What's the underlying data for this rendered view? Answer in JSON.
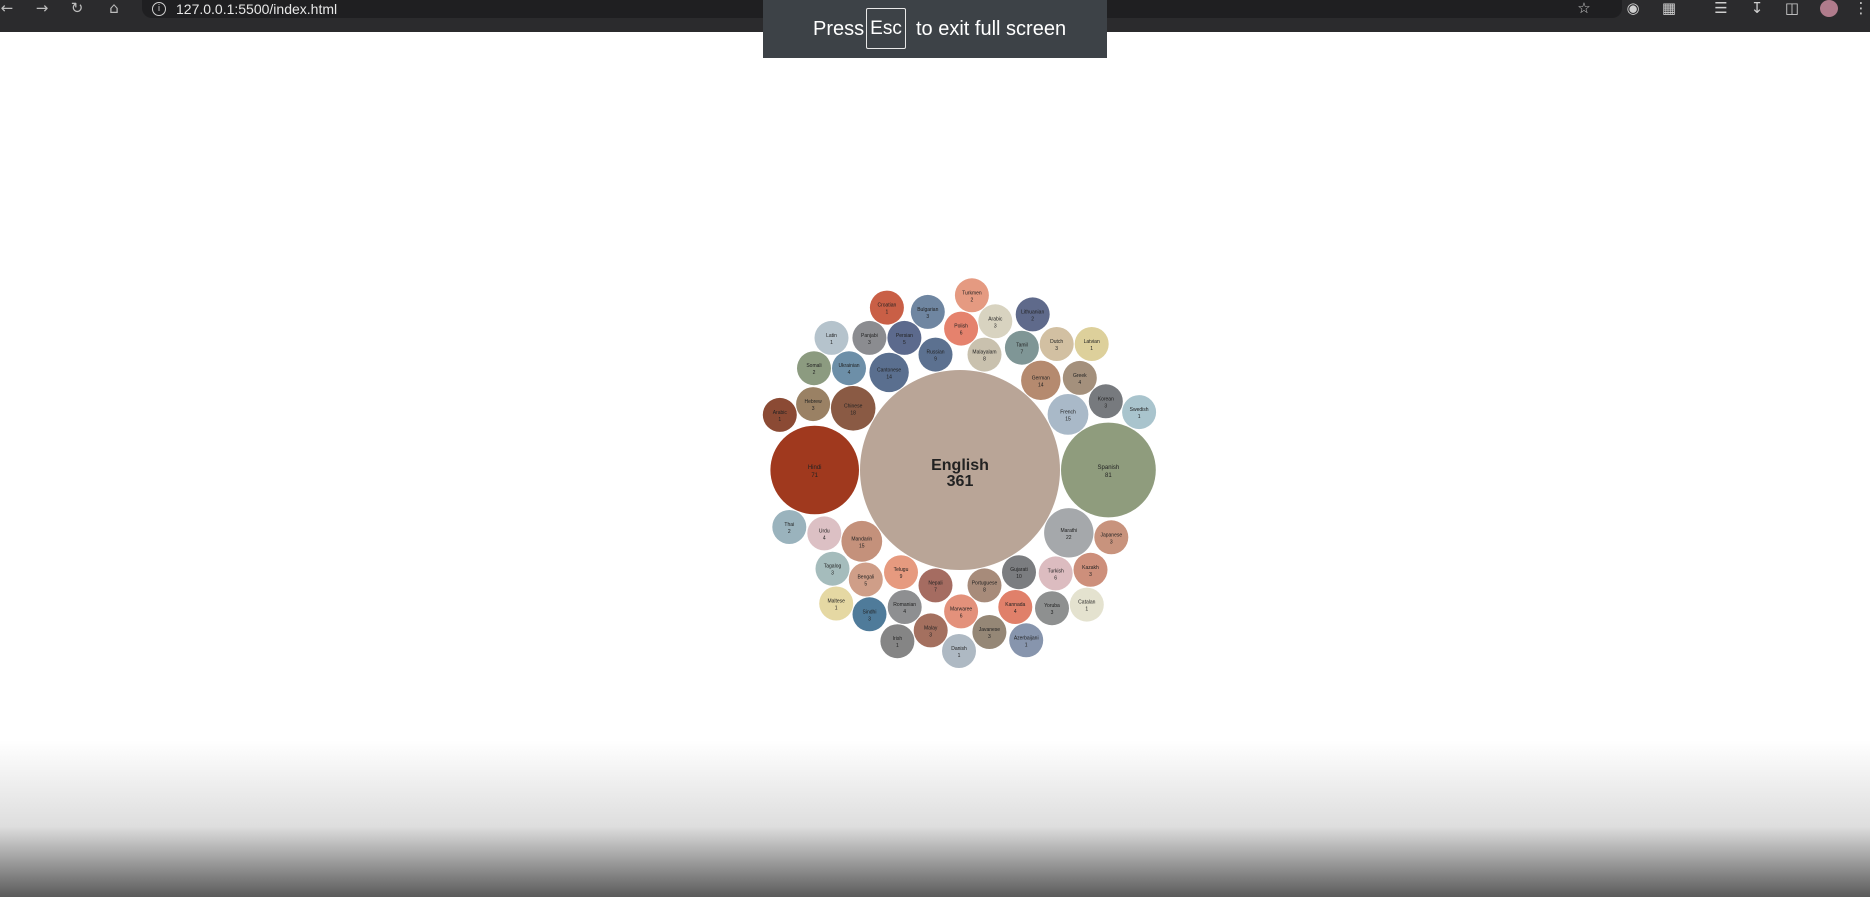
{
  "browser": {
    "url": "127.0.0.1:5500/index.html",
    "icons": [
      "back-icon",
      "forward-icon",
      "reload-icon",
      "home-icon",
      "info-icon",
      "star-icon",
      "camera-icon",
      "extensions-icon",
      "media-icon",
      "download-icon",
      "sidebar-icon",
      "avatar",
      "menu-icon"
    ]
  },
  "fullscreen_notice": {
    "prefix": "Press",
    "key": "Esc",
    "suffix": "to exit full screen"
  },
  "chart_data": {
    "type": "bubble",
    "title": "",
    "items": [
      {
        "name": "English",
        "value": 361,
        "color": "#b9a597"
      },
      {
        "name": "Spanish",
        "value": 81,
        "color": "#8f9c7d"
      },
      {
        "name": "Hindi",
        "value": 71,
        "color": "#a0391e"
      },
      {
        "name": "Marathi",
        "value": 22,
        "color": "#a5a8ab"
      },
      {
        "name": "Chinese",
        "value": 18,
        "color": "#8a5a44"
      },
      {
        "name": "French",
        "value": 15,
        "color": "#a9b9c8"
      },
      {
        "name": "Mandarin",
        "value": 15,
        "color": "#c4917b"
      },
      {
        "name": "German",
        "value": 14,
        "color": "#b58a6f"
      },
      {
        "name": "Cantonese",
        "value": 14,
        "color": "#5a6f8f"
      },
      {
        "name": "Gujarati",
        "value": 10,
        "color": "#7b7d80"
      },
      {
        "name": "Telugu",
        "value": 9,
        "color": "#e69a7f"
      },
      {
        "name": "Russian",
        "value": 9,
        "color": "#5c7190"
      },
      {
        "name": "Malayalam",
        "value": 8,
        "color": "#c9c1ae"
      },
      {
        "name": "Portuguese",
        "value": 8,
        "color": "#a78b7a"
      },
      {
        "name": "Nepali",
        "value": 7,
        "color": "#a56c61"
      },
      {
        "name": "Tamil",
        "value": 7,
        "color": "#7f9696"
      },
      {
        "name": "Turkish",
        "value": 6,
        "color": "#dcbcc0"
      },
      {
        "name": "Polish",
        "value": 6,
        "color": "#e5826d"
      },
      {
        "name": "Marwaree",
        "value": 6,
        "color": "#e3917b"
      },
      {
        "name": "Bengali",
        "value": 5,
        "color": "#cf9e88"
      },
      {
        "name": "Persian",
        "value": 5,
        "color": "#5c6a8d"
      },
      {
        "name": "Urdu",
        "value": 4,
        "color": "#dcc0c4"
      },
      {
        "name": "Greek",
        "value": 4,
        "color": "#a4907c"
      },
      {
        "name": "Ukrainian",
        "value": 4,
        "color": "#6d8fa8"
      },
      {
        "name": "Kannada",
        "value": 4,
        "color": "#e0806a"
      },
      {
        "name": "Romanian",
        "value": 4,
        "color": "#8e8f91"
      },
      {
        "name": "Arabic",
        "value": 3,
        "color": "#d8d3c0"
      },
      {
        "name": "Hebrew",
        "value": 3,
        "color": "#9a8164"
      },
      {
        "name": "Korean",
        "value": 3,
        "color": "#777a7e"
      },
      {
        "name": "Dutch",
        "value": 3,
        "color": "#d2c0a2"
      },
      {
        "name": "Tagalog",
        "value": 3,
        "color": "#a5bcbc"
      },
      {
        "name": "Panjabi",
        "value": 3,
        "color": "#8b8c90"
      },
      {
        "name": "Japanese",
        "value": 3,
        "color": "#c8937d"
      },
      {
        "name": "Kazakh",
        "value": 3,
        "color": "#cd8f7b"
      },
      {
        "name": "Bulgarian",
        "value": 3,
        "color": "#6f86a1"
      },
      {
        "name": "Malay",
        "value": 3,
        "color": "#a4705f"
      },
      {
        "name": "Yoruba",
        "value": 3,
        "color": "#8e9090"
      },
      {
        "name": "Javanese",
        "value": 3,
        "color": "#958776"
      },
      {
        "name": "Sindhi",
        "value": 3,
        "color": "#4f7b9a"
      },
      {
        "name": "Lithuanian",
        "value": 2,
        "color": "#5f6a8b"
      },
      {
        "name": "Thai",
        "value": 2,
        "color": "#9ab3bd"
      },
      {
        "name": "Somali",
        "value": 2,
        "color": "#8c9b80"
      },
      {
        "name": "Turkmen",
        "value": 2,
        "color": "#e59a81"
      },
      {
        "name": "Croatian",
        "value": 1,
        "color": "#c95f46"
      },
      {
        "name": "Latvian",
        "value": 1,
        "color": "#ddd09b"
      },
      {
        "name": "Maltese",
        "value": 1,
        "color": "#e5d8a3"
      },
      {
        "name": "Latin",
        "value": 1,
        "color": "#b5c3cc"
      },
      {
        "name": "Swedish",
        "value": 1,
        "color": "#a9c4cd"
      },
      {
        "name": "Arabic",
        "value": 1,
        "color": "#8b4a34"
      },
      {
        "name": "Catalan",
        "value": 1,
        "color": "#e4e2cf"
      },
      {
        "name": "Danish",
        "value": 1,
        "color": "#aeb9c3"
      },
      {
        "name": "Irish",
        "value": 1,
        "color": "#858585"
      },
      {
        "name": "Azerbaijani",
        "value": 1,
        "color": "#8795ad"
      }
    ]
  }
}
